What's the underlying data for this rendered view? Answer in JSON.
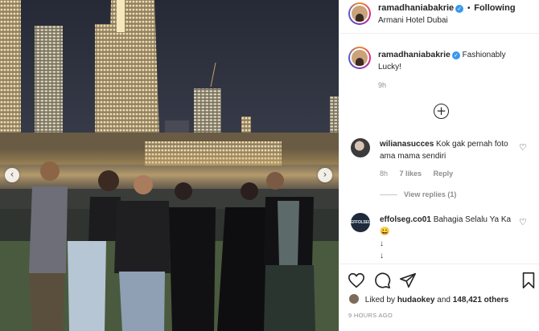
{
  "post": {
    "username": "ramadhaniabakrie",
    "follow_separator": "•",
    "follow_label": "Following",
    "location": "Armani Hotel Dubai",
    "verified_mark": "✓"
  },
  "caption": {
    "username": "ramadhaniabakrie",
    "text": "Fashionably Lucky!",
    "time": "9h"
  },
  "load_more_symbol": "+",
  "comments": [
    {
      "username": "wilianasucces",
      "text": "Kok gak pernah foto ama mama sendiri",
      "time": "8h",
      "likes": "7 likes",
      "reply_label": "Reply",
      "view_replies": "View replies (1)",
      "heart": "♡"
    },
    {
      "username": "effolseg.co01",
      "avatar_text": "EFFOLSEG.CO",
      "text": "Bahagia Selalu Ya Ka😀",
      "arrows": [
        "↓",
        "↓"
      ],
      "truncated": "↓ ...",
      "heart": "♡"
    }
  ],
  "likes": {
    "prefix": "Liked by",
    "user": "hudaokey",
    "joiner": "and",
    "count": "148,421 others"
  },
  "posted_ago": "9 HOURS AGO",
  "carousel": {
    "prev": "‹",
    "next": "›"
  },
  "icons": {
    "like": "heart-icon",
    "comment": "comment-icon",
    "share": "share-icon",
    "save": "bookmark-icon"
  }
}
